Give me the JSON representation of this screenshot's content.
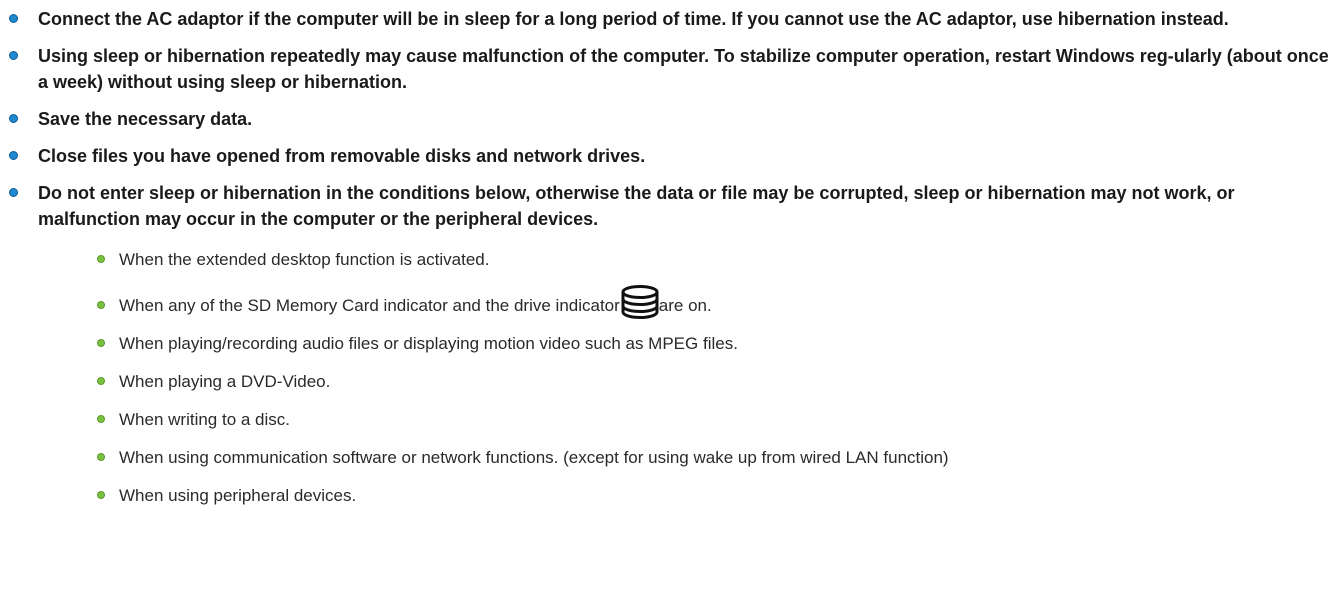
{
  "items": [
    "Connect the AC adaptor if the computer will be in sleep for a long period of time. If you cannot use the AC adaptor, use hibernation instead.",
    "Using sleep or hibernation repeatedly may cause malfunction of the computer. To stabilize computer operation, restart Windows reg-ularly (about once a week) without using sleep or hibernation.",
    "Save the necessary data.",
    "Close files you have opened from removable disks and network drives.",
    "Do not enter sleep or hibernation in the conditions below, otherwise the data or file may be corrupted, sleep or hibernation may not work, or malfunction may occur in the computer or the peripheral devices."
  ],
  "conditions": {
    "extended_desktop": "When the extended desktop function is activated.",
    "indicator_before": "When any of the SD Memory Card indicator and the drive indicator",
    "indicator_after": "are on.",
    "indicator_icon": "drive-indicator-icon",
    "audio_video": "When playing/recording audio files or displaying motion video such as MPEG files.",
    "dvd": "When playing a DVD-Video.",
    "disc": "When writing to a disc.",
    "network": "When using communication software or network functions. (except for using wake up from wired LAN function)",
    "peripheral": "When using peripheral devices."
  },
  "colors": {
    "main_bullet": "#1f88cf",
    "sub_bullet": "#7cc142"
  }
}
